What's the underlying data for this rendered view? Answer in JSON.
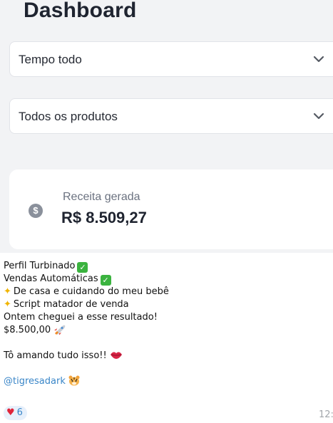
{
  "dashboard": {
    "title": "Dashboard",
    "period_filter": "Tempo todo",
    "product_filter": "Todos os produtos",
    "revenue_label": "Receita gerada",
    "revenue_value": "R$ 8.509,27"
  },
  "message": {
    "lines": [
      "Perfil Turbinado",
      "Vendas Automáticas",
      "De casa e cuidando do meu bebê",
      "Script matador  de venda",
      "Ontem cheguei a esse resultado!",
      "$8.500,00",
      "Tô amando tudo isso!!",
      "@tigresadark"
    ],
    "reaction_count": "6",
    "time": "12:"
  },
  "icons": {
    "check": "check-mark-emoji",
    "sparkles": "sparkles-emoji",
    "rocket": "rocket-emoji",
    "kiss": "kiss-lips-emoji",
    "tiger": "tiger-emoji",
    "heart": "red-heart-emoji",
    "coin": "dollar-coin-icon"
  },
  "colors": {
    "check_green": "#3bb33f",
    "link_blue": "#3a86c8",
    "heart_red": "#e0243a"
  }
}
